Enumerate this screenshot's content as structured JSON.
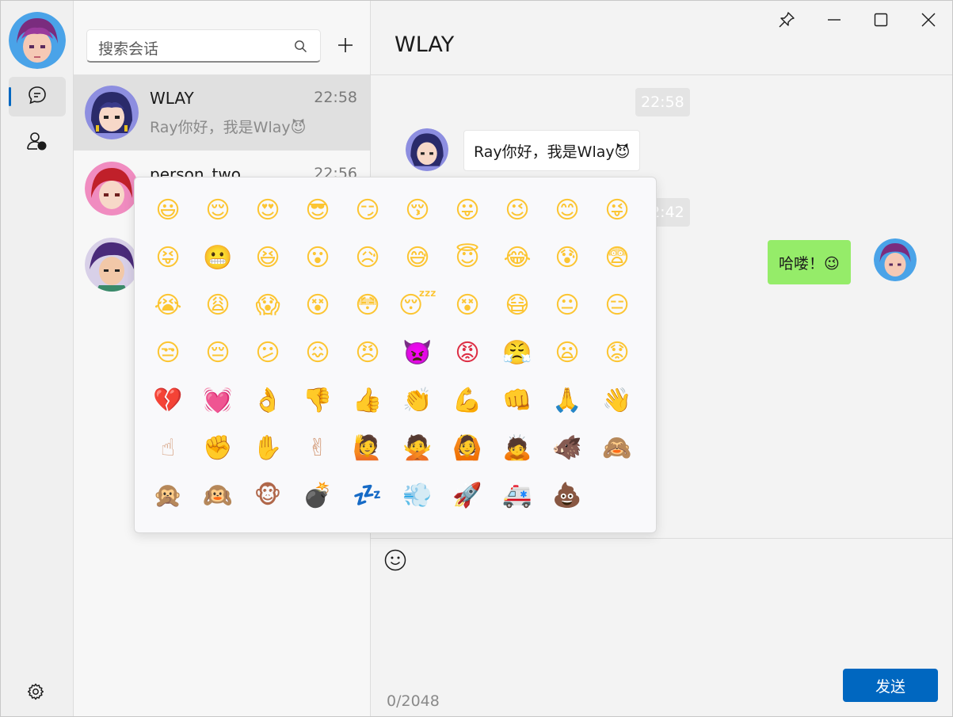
{
  "conversations": {
    "search_placeholder": "搜索会话",
    "items": [
      {
        "name": "WLAY",
        "time": "22:58",
        "preview": "Ray你好，我是Wlay😈"
      },
      {
        "name": "person_two",
        "time": "22:56",
        "preview": ""
      },
      {
        "name": "",
        "time": "",
        "preview": ""
      }
    ]
  },
  "chat": {
    "title": "WLAY",
    "messages": [
      {
        "type": "time",
        "text": "22:58"
      },
      {
        "type": "incoming",
        "text": "Ray你好，我是Wlay😈"
      },
      {
        "type": "time",
        "text": "22:42"
      },
      {
        "type": "outgoing",
        "text": "哈喽！😉"
      }
    ],
    "counter": "0/2048",
    "send_label": "发送"
  },
  "emoji_picker": {
    "emojis": [
      "😃",
      "😌",
      "😍",
      "😎",
      "😏",
      "😚",
      "😛",
      "😉",
      "😊",
      "😜",
      "😝",
      "😬",
      "😆",
      "😮",
      "😥",
      "😅",
      "😇",
      "😂",
      "😰",
      "😨",
      "😭",
      "😩",
      "😱",
      "😵",
      "😳",
      "😴",
      "😵",
      "😷",
      "😐",
      "😑",
      "😒",
      "😔",
      "😕",
      "😖",
      "😠",
      "👿",
      "😡",
      "😤",
      "😦",
      "😟",
      "💔",
      "💓",
      "👌",
      "👎",
      "👍",
      "👏",
      "💪",
      "👊",
      "🙏",
      "👋",
      "☝",
      "✊",
      "✋",
      "✌",
      "🙋",
      "🙅",
      "🙆",
      "🙇",
      "🐗",
      "🙈",
      "🙊",
      "🙉",
      "🐵",
      "💣",
      "💤",
      "💨",
      "🚀",
      "🚑",
      "💩"
    ]
  },
  "colors": {
    "accent": "#0067c0",
    "outgoing_bubble": "#95ec69",
    "emoji_yellow": "#fcc532",
    "heart_red": "#dd2e44",
    "devil_purple": "#8b60ca",
    "skin": "#d49c7a"
  }
}
